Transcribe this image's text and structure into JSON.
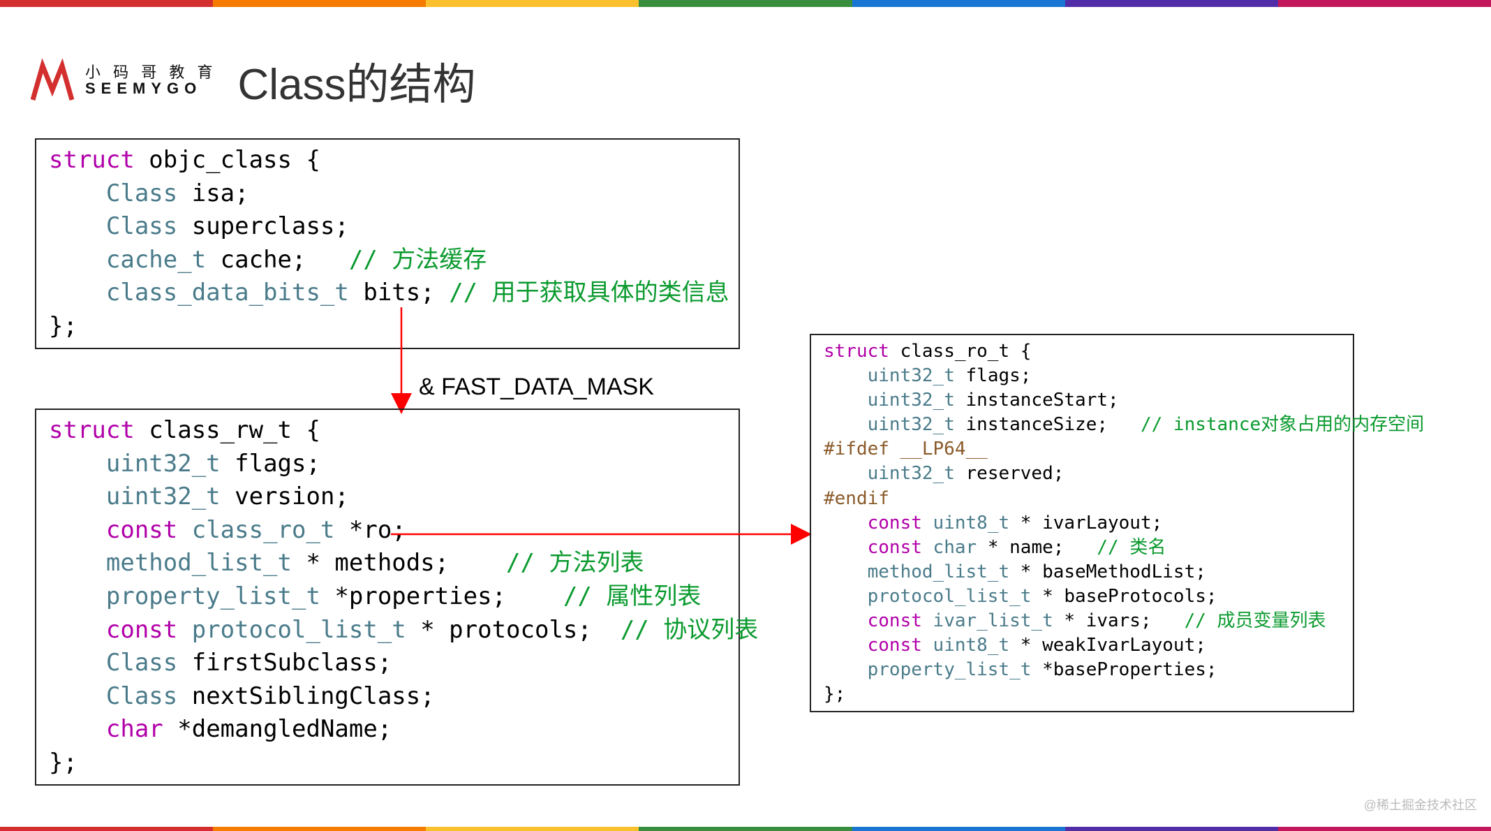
{
  "brand": {
    "cn": "小 码 哥 教 育",
    "en": "SEEMYGO"
  },
  "title": "Class的结构",
  "mask_label": "& FAST_DATA_MASK",
  "watermark": "@稀土掘金技术社区",
  "rainbow": [
    "#d32f2f",
    "#f57c00",
    "#fbc02d",
    "#388e3c",
    "#1976d2",
    "#512da8",
    "#c2185b"
  ],
  "box1": {
    "l0_kw": "struct",
    "l0_id": " objc_class {",
    "l1_ty": "Class",
    "l1_id": " isa;",
    "l2_ty": "Class",
    "l2_id": " superclass;",
    "l3_ty": "cache_t",
    "l3_id": " cache;",
    "l3_cm": "   // 方法缓存",
    "l4_ty": "class_data_bits_t",
    "l4_id": " bits;",
    "l4_cm": " // 用于获取具体的类信息",
    "l5": "};"
  },
  "box2": {
    "l0_kw": "struct",
    "l0_id": " class_rw_t {",
    "l1_ty": "uint32_t",
    "l1_id": " flags;",
    "l2_ty": "uint32_t",
    "l2_id": " version;",
    "l3_kw": "const ",
    "l3_ty": "class_ro_t",
    "l3_id": " *ro;",
    "l4_ty": "method_list_t",
    "l4_id": " * methods;",
    "l4_cm": "    // 方法列表",
    "l5_ty": "property_list_t",
    "l5_id": " *properties;",
    "l5_cm": "    // 属性列表",
    "l6_kw": "const ",
    "l6_ty": "protocol_list_t",
    "l6_id": " * protocols;",
    "l6_cm": "  // 协议列表",
    "l7_ty": "Class",
    "l7_id": " firstSubclass;",
    "l8_ty": "Class",
    "l8_id": " nextSiblingClass;",
    "l9_kw": "char",
    "l9_id": " *demangledName;",
    "l10": "};"
  },
  "box3": {
    "l0_kw": "struct",
    "l0_id": " class_ro_t {",
    "l1_ty": "uint32_t",
    "l1_id": " flags;",
    "l2_ty": "uint32_t",
    "l2_id": " instanceStart;",
    "l3_ty": "uint32_t",
    "l3_id": " instanceSize;",
    "l3_cm": "   // instance对象占用的内存空间",
    "l4_pp": "#ifdef __LP64__",
    "l5_ty": "uint32_t",
    "l5_id": " reserved;",
    "l6_pp": "#endif",
    "l7_kw": "const ",
    "l7_ty": "uint8_t",
    "l7_id": " * ivarLayout;",
    "l8_kw": "const ",
    "l8_ty": "char",
    "l8_id": " * name;",
    "l8_cm": "   // 类名",
    "l9_ty": "method_list_t",
    "l9_id": " * baseMethodList;",
    "l10_ty": "protocol_list_t",
    "l10_id": " * baseProtocols;",
    "l11_kw": "const ",
    "l11_ty": "ivar_list_t",
    "l11_id": " * ivars;",
    "l11_cm": "   // 成员变量列表",
    "l12_kw": "const ",
    "l12_ty": "uint8_t",
    "l12_id": " * weakIvarLayout;",
    "l13_ty": "property_list_t",
    "l13_id": " *baseProperties;",
    "l14": "};"
  }
}
